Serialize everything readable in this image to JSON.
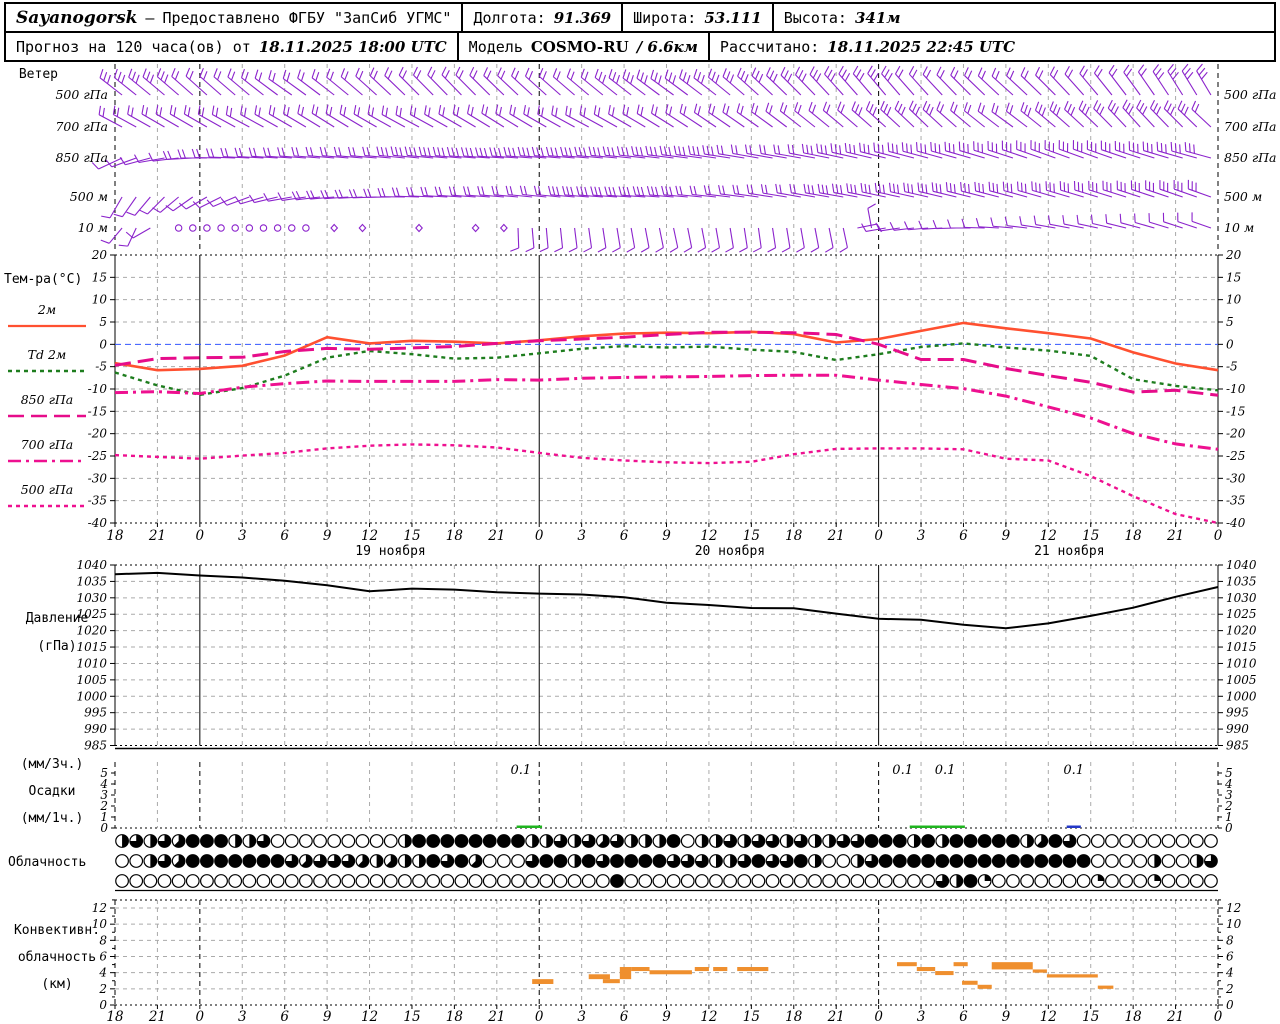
{
  "header": {
    "station": "Sayanogorsk",
    "dash": "—",
    "provider": "Предоставлено ФГБУ \"ЗапСиб УГМС\"",
    "lon_label": "Долгота:",
    "lon_value": "91.369",
    "lat_label": "Широта:",
    "lat_value": "53.111",
    "alt_label": "Высота:",
    "alt_value": "341м",
    "forecast_label": "Прогноз на 120 часа(ов) от",
    "forecast_value": "18.11.2025 18:00 UTC",
    "model_label": "Модель",
    "model_value": "COSMO-RU",
    "model_res": "/ 6.6км",
    "calc_label": "Рассчитано:",
    "calc_value": "18.11.2025 22:45 UTC"
  },
  "chart_data": {
    "type": "meteogram",
    "hours": [
      "18",
      "21",
      "0",
      "3",
      "6",
      "9",
      "12",
      "15",
      "18",
      "21",
      "0",
      "3",
      "6",
      "9",
      "12",
      "15",
      "18",
      "21",
      "0",
      "3",
      "6",
      "9",
      "12",
      "15",
      "18",
      "21",
      "0"
    ],
    "day_labels": [
      {
        "text": "19 ноября",
        "tick": 6
      },
      {
        "text": "20 ноября",
        "tick": 14
      },
      {
        "text": "21 ноября",
        "tick": 22
      }
    ],
    "wind": {
      "title": "Ветер",
      "rows": [
        {
          "num": "500",
          "unit": "гПа",
          "dirs": [
            -52,
            -50,
            -48,
            -50,
            -55,
            -52,
            -48,
            -45,
            -44,
            -46,
            -48,
            -50,
            -52,
            -54,
            -52,
            -48,
            -45,
            -42,
            -40,
            -42,
            -45,
            -48,
            -45,
            -40,
            -36,
            -32,
            -30
          ],
          "spd": [
            3,
            3,
            2,
            2,
            2,
            2,
            2,
            2,
            2,
            2,
            2,
            2,
            3,
            3,
            3,
            3,
            3,
            3,
            3,
            2,
            2,
            2,
            2,
            2,
            2,
            3,
            3
          ]
        },
        {
          "num": "700",
          "unit": "гПа",
          "dirs": [
            -62,
            -60,
            -60,
            -62,
            -60,
            -58,
            -60,
            -62,
            -60,
            -58,
            -60,
            -62,
            -60,
            -58,
            -56,
            -55,
            -52,
            -50,
            -48,
            -46,
            -50,
            -54,
            -50,
            -46,
            -42,
            -45,
            -48
          ],
          "spd": [
            2,
            2,
            2,
            2,
            2,
            2,
            2,
            2,
            2,
            2,
            2,
            2,
            2,
            2,
            2,
            2,
            2,
            2,
            3,
            3,
            2,
            2,
            3,
            3,
            3,
            3,
            2
          ]
        },
        {
          "num": "850",
          "unit": "гПа",
          "dirs": [
            -115,
            -100,
            -90,
            -87,
            -86,
            -85,
            -85,
            -84,
            -85,
            -86,
            -85,
            -85,
            -84,
            -83,
            -82,
            -80,
            -80,
            -78,
            -76,
            -75,
            -74,
            -72,
            -70,
            -70,
            -72,
            -74,
            -75
          ],
          "spd": [
            1,
            1,
            2,
            2,
            2,
            2,
            2,
            3,
            3,
            3,
            3,
            3,
            3,
            3,
            3,
            2,
            2,
            3,
            3,
            3,
            3,
            3,
            3,
            3,
            3,
            3,
            3
          ]
        },
        {
          "num": "500",
          "unit": "м",
          "dirs": [
            -150,
            -135,
            -120,
            -110,
            -100,
            -95,
            -92,
            -88,
            -86,
            -85,
            -84,
            -85,
            -86,
            -85,
            -84,
            -82,
            -80,
            -80,
            -78,
            -77,
            -76,
            -75,
            -74,
            -73,
            -72,
            -71,
            -70
          ],
          "spd": [
            1,
            1,
            1,
            1,
            1,
            2,
            2,
            2,
            2,
            2,
            2,
            3,
            3,
            3,
            2,
            2,
            2,
            3,
            3,
            3,
            3,
            3,
            3,
            3,
            3,
            3,
            3
          ]
        },
        {
          "num": "10",
          "unit": "м",
          "dirs": [
            -140,
            null,
            null,
            null,
            null,
            null,
            null,
            null,
            null,
            null,
            175,
            172,
            170,
            168,
            170,
            172,
            170,
            168,
            -100,
            -95,
            -90,
            -85,
            -80,
            -78,
            -75,
            -72,
            -70
          ],
          "spd": [
            1,
            0,
            0,
            0,
            0,
            0,
            0,
            0,
            0,
            0,
            1,
            1,
            1,
            1,
            1,
            1,
            1,
            1,
            1,
            1,
            1,
            1,
            1,
            1,
            1,
            1,
            1
          ],
          "calm_circles": [
            4,
            5,
            6,
            7,
            8,
            9,
            10,
            11,
            12,
            13
          ],
          "calm_diamonds": [
            15,
            17,
            21,
            25,
            27
          ],
          "extra_barbs": [
            {
              "h": 0,
              "a": -140,
              "s": 1
            },
            {
              "h": 1,
              "a": -155,
              "s": 1
            },
            {
              "h": 2,
              "a": -120,
              "s": 1
            },
            {
              "h": 28,
              "a": 178,
              "s": 1
            },
            {
              "h": 29,
              "a": 175,
              "s": 1
            }
          ]
        }
      ]
    },
    "temperature": {
      "title": "Тем-ра(°C)",
      "ylim": [
        -40,
        20
      ],
      "yticks": [
        "20",
        "15",
        "10",
        "5",
        "0",
        "-5",
        "-10",
        "-15",
        "-20",
        "-25",
        "-30",
        "-35",
        "-40"
      ],
      "series": [
        {
          "name": "2м",
          "style": "solid",
          "color": "#ff5030",
          "values": [
            -4.2,
            -5.8,
            -5.5,
            -4.8,
            -2.5,
            1.6,
            0.2,
            0.8,
            0.6,
            0.2,
            0.9,
            1.8,
            2.4,
            2.6,
            2.5,
            2.8,
            2.3,
            0.4,
            1.2,
            3.0,
            4.8,
            3.6,
            2.5,
            1.3,
            -1.8,
            -4.3,
            -5.8
          ]
        },
        {
          "name": "Td 2м",
          "style": "dotted",
          "color": "#1e7d1e",
          "values": [
            -6.3,
            -9.2,
            -11.3,
            -9.8,
            -7.0,
            -3.0,
            -1.5,
            -2.2,
            -3.2,
            -3.0,
            -2.0,
            -1.0,
            -0.4,
            -0.7,
            -0.5,
            -1.2,
            -1.7,
            -3.5,
            -2.2,
            -0.6,
            0.2,
            -0.7,
            -1.4,
            -2.6,
            -7.8,
            -9.3,
            -10.3
          ]
        },
        {
          "name": "850 гПа",
          "style": "longdash",
          "color": "#e60c8a",
          "values": [
            -4.7,
            -3.2,
            -3.0,
            -2.9,
            -1.6,
            -0.9,
            -1.1,
            -0.8,
            -0.5,
            0.2,
            0.8,
            1.2,
            1.6,
            2.2,
            2.7,
            2.7,
            2.6,
            2.2,
            0.0,
            -3.4,
            -3.4,
            -5.4,
            -7.0,
            -8.5,
            -10.7,
            -10.3,
            -11.4
          ]
        },
        {
          "name": "700 гПа",
          "style": "dashdot",
          "color": "#ee1090",
          "values": [
            -10.8,
            -10.6,
            -11.0,
            -9.6,
            -8.8,
            -8.2,
            -8.3,
            -8.3,
            -8.3,
            -7.9,
            -8.0,
            -7.6,
            -7.4,
            -7.3,
            -7.2,
            -7.0,
            -6.9,
            -6.9,
            -8.0,
            -9.0,
            -9.9,
            -11.6,
            -14.0,
            -16.5,
            -20.0,
            -22.3,
            -23.5
          ]
        },
        {
          "name": "500 гПа",
          "style": "dotted",
          "color": "#ee1090",
          "values": [
            -24.8,
            -25.2,
            -25.6,
            -24.9,
            -24.3,
            -23.3,
            -22.7,
            -22.4,
            -22.6,
            -23.1,
            -24.3,
            -25.4,
            -26.0,
            -26.4,
            -26.6,
            -26.3,
            -24.6,
            -23.4,
            -23.3,
            -23.3,
            -23.5,
            -25.6,
            -26.0,
            -29.5,
            -34.0,
            -38.0,
            -40.0
          ]
        }
      ]
    },
    "pressure": {
      "label1": "Давление",
      "label2": "(гПа)",
      "ylim": [
        985,
        1040
      ],
      "yticks": [
        "1040",
        "1035",
        "1030",
        "1025",
        "1020",
        "1015",
        "1010",
        "1005",
        "1000",
        "995",
        "990",
        "985"
      ],
      "values": [
        1037.2,
        1037.6,
        1036.8,
        1036.2,
        1035.2,
        1033.8,
        1032.0,
        1032.8,
        1032.5,
        1031.7,
        1031.3,
        1031.0,
        1030.2,
        1028.5,
        1027.8,
        1026.9,
        1026.8,
        1025.2,
        1023.6,
        1023.3,
        1021.8,
        1020.7,
        1022.2,
        1024.5,
        1027.0,
        1030.3,
        1033.3
      ]
    },
    "precip": {
      "label_top": "(мм/3ч.)",
      "label_mid": "Осадки",
      "label_bot": "(мм/1ч.)",
      "ylim": [
        0,
        6
      ],
      "yticks": [
        "5",
        "4",
        "3",
        "2",
        "1",
        "0"
      ],
      "bars": [
        {
          "h1": 28.4,
          "h2": 30.2,
          "value": 0.15,
          "color": "green",
          "label": "0.1",
          "label_h": 28.7
        },
        {
          "h1": 56.2,
          "h2": 58.3,
          "value": 0.2,
          "color": "green",
          "label": "0.1",
          "label_h": 55.7
        },
        {
          "h1": 58.3,
          "h2": 60.1,
          "value": 0.1,
          "color": "green",
          "label": "0.1",
          "label_h": 58.7
        },
        {
          "h1": 67.3,
          "h2": 68.3,
          "value": 0.12,
          "color": "blue",
          "label": "0.1",
          "label_h": 67.8
        }
      ]
    },
    "cloud": {
      "label": "Облачность",
      "rows_eighths": [
        [
          4,
          6,
          4,
          6,
          5,
          8,
          8,
          8,
          4,
          4,
          6,
          0,
          0,
          0,
          0,
          0,
          0,
          0,
          0,
          0,
          4,
          8,
          8,
          8,
          8,
          8,
          8,
          8,
          8,
          4,
          4,
          6,
          4,
          6,
          5,
          6,
          4,
          4,
          4,
          8,
          0,
          4,
          4,
          6,
          4,
          6,
          6,
          4,
          6,
          4,
          4,
          6,
          6,
          8,
          8,
          8,
          4,
          8,
          4,
          8,
          8,
          8,
          8,
          8,
          4,
          5,
          8,
          6,
          0,
          0,
          0,
          0,
          0,
          0,
          0,
          0,
          0,
          0
        ],
        [
          0,
          0,
          4,
          6,
          5,
          8,
          8,
          8,
          8,
          8,
          8,
          8,
          6,
          5,
          6,
          6,
          6,
          5,
          4,
          5,
          4,
          4,
          8,
          6,
          8,
          5,
          0,
          0,
          0,
          6,
          8,
          8,
          4,
          8,
          6,
          8,
          8,
          8,
          8,
          6,
          6,
          6,
          4,
          4,
          6,
          8,
          6,
          6,
          8,
          4,
          0,
          0,
          4,
          6,
          8,
          8,
          8,
          8,
          8,
          8,
          8,
          8,
          8,
          8,
          8,
          8,
          8,
          8,
          8,
          0,
          0,
          0,
          0,
          4,
          0,
          0,
          4,
          6
        ],
        [
          0,
          0,
          0,
          0,
          0,
          0,
          0,
          0,
          0,
          0,
          0,
          0,
          0,
          0,
          0,
          0,
          0,
          0,
          0,
          0,
          0,
          0,
          0,
          0,
          0,
          0,
          0,
          0,
          0,
          0,
          0,
          0,
          0,
          0,
          0,
          8,
          0,
          0,
          0,
          0,
          0,
          0,
          0,
          0,
          0,
          0,
          0,
          0,
          0,
          0,
          0,
          0,
          0,
          0,
          0,
          0,
          0,
          0,
          6,
          4,
          8,
          2,
          0,
          0,
          0,
          0,
          0,
          0,
          0,
          2,
          0,
          0,
          0,
          2,
          0,
          0,
          0,
          0
        ]
      ]
    },
    "convective": {
      "label1": "Конвективн.",
      "label2": "облачность",
      "label3": "(км)",
      "ylim": [
        0,
        12
      ],
      "yticks": [
        "12",
        "10",
        "8",
        "6",
        "4",
        "2",
        "0"
      ],
      "bars": [
        [
          29.5,
          31,
          2.6,
          3.2
        ],
        [
          33.5,
          35,
          3.2,
          3.8
        ],
        [
          34.5,
          35.7,
          2.7,
          3.2
        ],
        [
          35.7,
          36.5,
          3.2,
          4.7
        ],
        [
          36.5,
          37.8,
          4.2,
          4.7
        ],
        [
          37.8,
          40.8,
          3.8,
          4.3
        ],
        [
          41,
          42,
          4.2,
          4.7
        ],
        [
          42.3,
          43.3,
          4.2,
          4.7
        ],
        [
          44,
          46.2,
          4.2,
          4.7
        ],
        [
          55.3,
          56.7,
          4.8,
          5.3
        ],
        [
          56.7,
          58,
          4.2,
          4.7
        ],
        [
          58,
          59.3,
          3.7,
          4.2
        ],
        [
          59.3,
          60.3,
          4.8,
          5.3
        ],
        [
          59.9,
          61,
          2.5,
          3.0
        ],
        [
          61,
          62,
          2.0,
          2.5
        ],
        [
          62,
          64.9,
          4.4,
          5.3
        ],
        [
          64.9,
          65.9,
          4.0,
          4.4
        ],
        [
          65.9,
          69.5,
          3.4,
          3.8
        ],
        [
          69.5,
          70.6,
          2.0,
          2.4
        ]
      ]
    },
    "colors": {
      "barb": "#8b23cc",
      "grid": "#aaaaaa",
      "zero_line": "#3355ff",
      "pressure_line": "#000000",
      "precip_green": "#1fb41f",
      "precip_blue": "#2438c8",
      "convective_bar": "#ef8f2e"
    }
  }
}
